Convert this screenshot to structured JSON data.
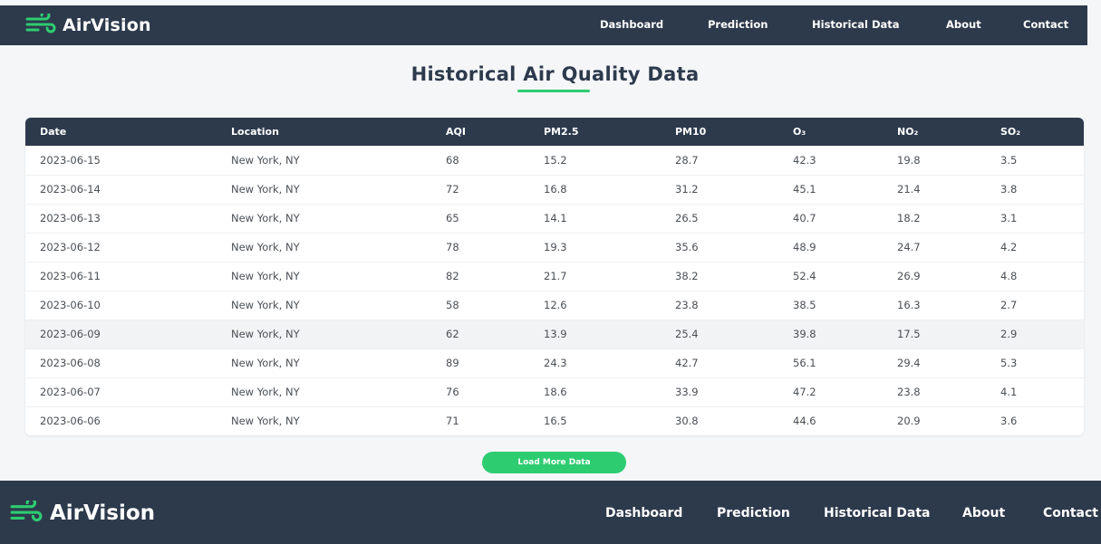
{
  "brand": {
    "name": "AirVision",
    "accent_color": "#2ecc71",
    "icon": "wind-icon"
  },
  "nav": {
    "links": [
      "Dashboard",
      "Prediction",
      "Historical Data",
      "About",
      "Contact"
    ]
  },
  "page": {
    "title": "Historical Air Quality Data"
  },
  "table": {
    "columns": [
      "Date",
      "Location",
      "AQI",
      "PM2.5",
      "PM10",
      "O₃",
      "NO₂",
      "SO₂"
    ],
    "rows": [
      [
        "2023-06-15",
        "New York, NY",
        "68",
        "15.2",
        "28.7",
        "42.3",
        "19.8",
        "3.5"
      ],
      [
        "2023-06-14",
        "New York, NY",
        "72",
        "16.8",
        "31.2",
        "45.1",
        "21.4",
        "3.8"
      ],
      [
        "2023-06-13",
        "New York, NY",
        "65",
        "14.1",
        "26.5",
        "40.7",
        "18.2",
        "3.1"
      ],
      [
        "2023-06-12",
        "New York, NY",
        "78",
        "19.3",
        "35.6",
        "48.9",
        "24.7",
        "4.2"
      ],
      [
        "2023-06-11",
        "New York, NY",
        "82",
        "21.7",
        "38.2",
        "52.4",
        "26.9",
        "4.8"
      ],
      [
        "2023-06-10",
        "New York, NY",
        "58",
        "12.6",
        "23.8",
        "38.5",
        "16.3",
        "2.7"
      ],
      [
        "2023-06-09",
        "New York, NY",
        "62",
        "13.9",
        "25.4",
        "39.8",
        "17.5",
        "2.9"
      ],
      [
        "2023-06-08",
        "New York, NY",
        "89",
        "24.3",
        "42.7",
        "56.1",
        "29.4",
        "5.3"
      ],
      [
        "2023-06-07",
        "New York, NY",
        "76",
        "18.6",
        "33.9",
        "47.2",
        "23.8",
        "4.1"
      ],
      [
        "2023-06-06",
        "New York, NY",
        "71",
        "16.5",
        "30.8",
        "44.6",
        "20.9",
        "3.6"
      ]
    ],
    "highlighted_row": 6
  },
  "actions": {
    "load_more_label": "Load More Data"
  },
  "footer": {
    "brand_name": "AirVision",
    "links": [
      "Dashboard",
      "Prediction",
      "Historical Data",
      "About",
      "Contact"
    ]
  },
  "colors": {
    "dark": "#2d3a4c",
    "accent": "#2ecc71",
    "background": "#f4f6f8"
  }
}
